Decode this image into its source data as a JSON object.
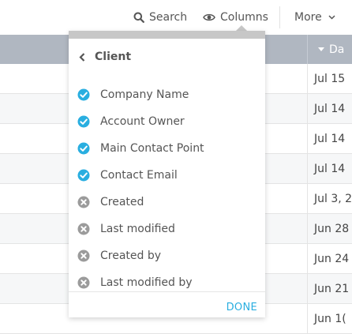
{
  "toolbar": {
    "search_label": "Search",
    "columns_label": "Columns",
    "more_label": "More"
  },
  "table": {
    "date_header": "Da",
    "dates": [
      "Jul 15",
      "Jul 14",
      "Jul 14",
      "Jul 14",
      "Jul 3, 2",
      "Jun 28",
      "Jun 24",
      "Jun 21",
      "Jun 1("
    ]
  },
  "columns_menu": {
    "title": "Client",
    "items": [
      {
        "label": "Company Name",
        "checked": true
      },
      {
        "label": "Account Owner",
        "checked": true
      },
      {
        "label": "Main Contact Point",
        "checked": true
      },
      {
        "label": "Contact Email",
        "checked": true
      },
      {
        "label": "Created",
        "checked": false
      },
      {
        "label": "Last modified",
        "checked": false
      },
      {
        "label": "Created by",
        "checked": false
      },
      {
        "label": "Last modified by",
        "checked": false
      }
    ],
    "done_label": "DONE"
  },
  "colors": {
    "checked": "#29aee0",
    "unchecked": "#9b9b9b",
    "header_bg": "#b0b7c1",
    "accent": "#29aee0"
  },
  "icons": {
    "search": "search-icon",
    "columns": "eye-icon",
    "more": "chevron-down-icon",
    "back": "chevron-left-icon",
    "checked": "check-circle-icon",
    "unchecked": "x-circle-icon"
  }
}
